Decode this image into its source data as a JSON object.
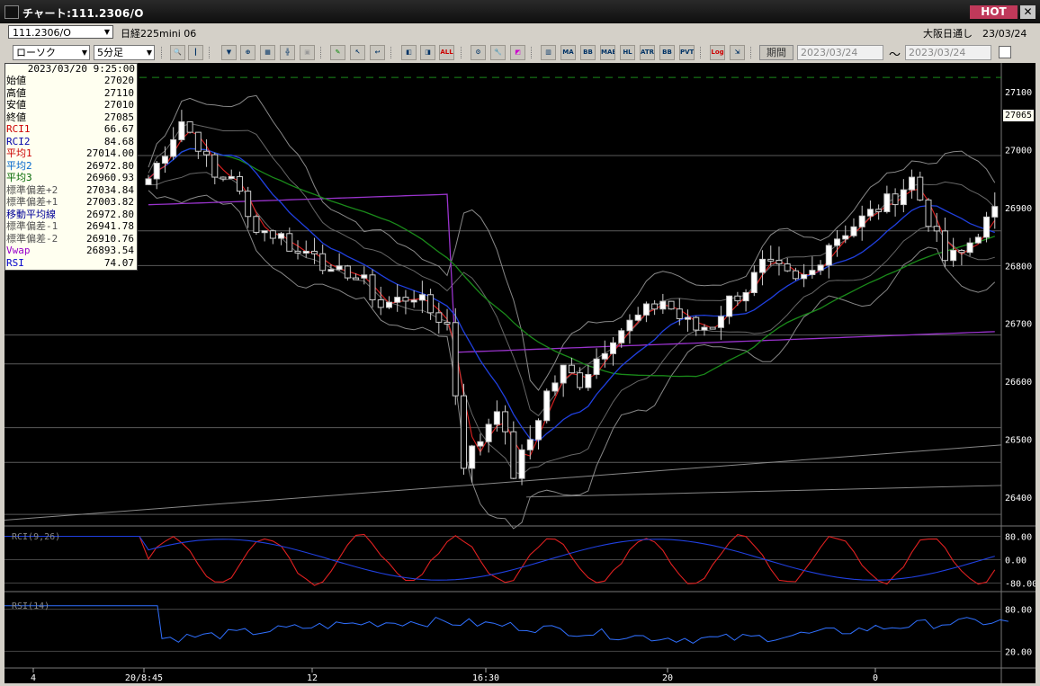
{
  "window": {
    "title": "チャート:111.2306/O",
    "hot": "HOT",
    "close": "✕"
  },
  "header": {
    "symbol": "111.2306/O",
    "symbol_name": "日経225mini 06",
    "exchange": "大阪日通し",
    "date": "23/03/24"
  },
  "toolbar": {
    "chart_type": "ローソク",
    "interval": "5分足",
    "buttons": [
      "zoom",
      "cursor",
      "bar",
      "zoomin",
      "chart",
      "crossline",
      "gray",
      "pen",
      "select",
      "undo",
      "draw1",
      "draw2",
      "all",
      "settings",
      "brush",
      "color",
      "bar1",
      "MA",
      "BB",
      "MAE",
      "HL",
      "ATR",
      "BB2",
      "PVT",
      "Log",
      "export"
    ],
    "period_label": "期間",
    "date_from": "2023/03/24",
    "tilde": "～",
    "date_to": "2023/03/24"
  },
  "info_panel": {
    "datetime": "2023/03/20 9:25:00",
    "rows": [
      {
        "label": "始値",
        "value": "27020",
        "color": "#000000"
      },
      {
        "label": "高値",
        "value": "27110",
        "color": "#000000"
      },
      {
        "label": "安値",
        "value": "27010",
        "color": "#000000"
      },
      {
        "label": "終値",
        "value": "27085",
        "color": "#000000"
      },
      {
        "label": "RCI1",
        "value": "66.67",
        "color": "#cc0000"
      },
      {
        "label": "RCI2",
        "value": "84.68",
        "color": "#0000aa"
      },
      {
        "label": "平均1",
        "value": "27014.00",
        "color": "#cc0000"
      },
      {
        "label": "平均2",
        "value": "26972.80",
        "color": "#0066cc"
      },
      {
        "label": "平均3",
        "value": "26960.93",
        "color": "#006600"
      },
      {
        "label": "標準偏差+2",
        "value": "27034.84",
        "color": "#555555"
      },
      {
        "label": "標準偏差+1",
        "value": "27003.82",
        "color": "#555555"
      },
      {
        "label": "移動平均線",
        "value": "26972.80",
        "color": "#000099"
      },
      {
        "label": "標準偏差-1",
        "value": "26941.78",
        "color": "#555555"
      },
      {
        "label": "標準偏差-2",
        "value": "26910.76",
        "color": "#555555"
      },
      {
        "label": "Vwap",
        "value": "26893.54",
        "color": "#9900cc"
      },
      {
        "label": "RSI",
        "value": "74.07",
        "color": "#0000cc"
      }
    ]
  },
  "price_axis": {
    "ticks": [
      "27100",
      "27000",
      "26900",
      "26800",
      "26700",
      "26600",
      "26500",
      "26400"
    ],
    "current": "27065"
  },
  "time_axis": {
    "ticks": [
      "4",
      "20/8:45",
      "12",
      "16:30",
      "20",
      "0"
    ]
  },
  "rci_panel": {
    "label": "RCI(9,26)",
    "ticks": [
      "80.00",
      "0.00",
      "-80.00"
    ]
  },
  "rsi_panel": {
    "label": "RSI(14)",
    "ticks": [
      "80.00",
      "20.00"
    ]
  },
  "chart_data": {
    "type": "candlestick",
    "y_range": [
      26350,
      27150
    ],
    "close_path": [
      [
        0,
        26950
      ],
      [
        2,
        27000
      ],
      [
        4,
        27050
      ],
      [
        6,
        27010
      ],
      [
        8,
        26950
      ],
      [
        10,
        26960
      ],
      [
        12,
        26880
      ],
      [
        14,
        26860
      ],
      [
        16,
        26850
      ],
      [
        18,
        26820
      ],
      [
        20,
        26830
      ],
      [
        22,
        26780
      ],
      [
        24,
        26790
      ],
      [
        26,
        26770
      ],
      [
        28,
        26730
      ],
      [
        30,
        26740
      ],
      [
        32,
        26750
      ],
      [
        34,
        26720
      ],
      [
        36,
        26700
      ],
      [
        38,
        26460
      ],
      [
        40,
        26500
      ],
      [
        42,
        26560
      ],
      [
        44,
        26440
      ],
      [
        46,
        26500
      ],
      [
        48,
        26580
      ],
      [
        50,
        26620
      ],
      [
        52,
        26600
      ],
      [
        54,
        26640
      ],
      [
        56,
        26680
      ],
      [
        58,
        26700
      ],
      [
        60,
        26720
      ],
      [
        62,
        26740
      ],
      [
        64,
        26710
      ],
      [
        66,
        26690
      ],
      [
        68,
        26700
      ],
      [
        70,
        26740
      ],
      [
        72,
        26760
      ],
      [
        74,
        26800
      ],
      [
        76,
        26790
      ],
      [
        78,
        26770
      ],
      [
        80,
        26790
      ],
      [
        82,
        26840
      ],
      [
        84,
        26860
      ],
      [
        86,
        26880
      ],
      [
        88,
        26900
      ],
      [
        90,
        26920
      ],
      [
        92,
        26950
      ],
      [
        94,
        26880
      ],
      [
        96,
        26810
      ],
      [
        98,
        26820
      ],
      [
        100,
        26860
      ],
      [
        102,
        26890
      ]
    ],
    "candle_count": 103
  }
}
